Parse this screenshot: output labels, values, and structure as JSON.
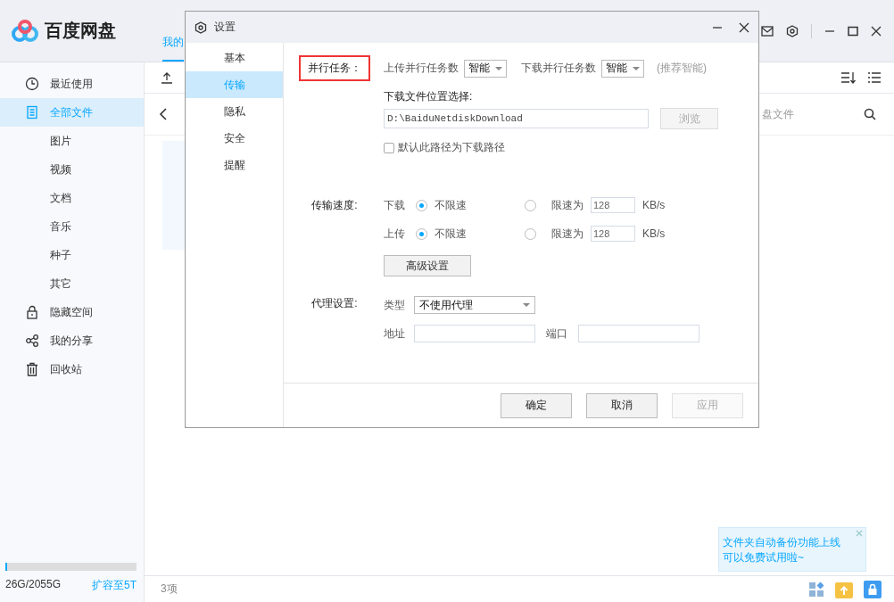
{
  "app": {
    "logo": "百度网盘",
    "tab": "我的"
  },
  "sidebar": {
    "items": [
      {
        "label": "最近使用",
        "selected": false
      },
      {
        "label": "全部文件",
        "selected": true,
        "children": [
          {
            "label": "图片",
            "selected": false
          },
          {
            "label": "视频",
            "selected": false
          },
          {
            "label": "文档",
            "selected": false
          },
          {
            "label": "音乐",
            "selected": false
          },
          {
            "label": "种子",
            "selected": false
          },
          {
            "label": "其它",
            "selected": false
          }
        ]
      },
      {
        "label": "隐藏空间",
        "selected": false
      },
      {
        "label": "我的分享",
        "selected": false
      },
      {
        "label": "回收站",
        "selected": false
      }
    ],
    "storage": {
      "text": "26G/2055G",
      "level": 0.013,
      "upgrade": "扩容至5T"
    }
  },
  "content": {
    "search_placeholder": "盘文件",
    "item_count": "3项"
  },
  "toast": {
    "lines": [
      "文件夹自动备份功能上线",
      "可以免费试用啦~"
    ]
  },
  "dialog": {
    "title": "设置",
    "nav": [
      {
        "label": "基本",
        "selected": false
      },
      {
        "label": "传输",
        "selected": true
      },
      {
        "label": "隐私",
        "selected": false
      },
      {
        "label": "安全",
        "selected": false
      },
      {
        "label": "提醒",
        "selected": false
      }
    ],
    "parallel": {
      "label": "并行任务：",
      "highlighted": true,
      "upload_label": "上传并行任务数",
      "upload_value": "智能",
      "download_label": "下载并行任务数",
      "download_value": "智能",
      "hint": "(推荐智能)"
    },
    "location": {
      "label": "下载文件位置选择:",
      "path": "D:\\BaiduNetdiskDownload",
      "browse": "浏览",
      "browse_disabled": true,
      "default_label": "默认此路径为下载路径",
      "default_checked": false
    },
    "speed": {
      "label": "传输速度:",
      "rows": [
        {
          "direction": "下载",
          "unlimited_label": "不限速",
          "unlimited": true,
          "limit_label": "限速为",
          "limit_value": "128",
          "unit": "KB/s"
        },
        {
          "direction": "上传",
          "unlimited_label": "不限速",
          "unlimited": true,
          "limit_label": "限速为",
          "limit_value": "128",
          "unit": "KB/s"
        }
      ],
      "advanced": "高级设置"
    },
    "proxy": {
      "label": "代理设置:",
      "type_label": "类型",
      "type_value": "不使用代理",
      "address_label": "地址",
      "port_label": "端口"
    },
    "buttons": [
      {
        "label": "确定",
        "disabled": false
      },
      {
        "label": "取消",
        "disabled": false
      },
      {
        "label": "应用",
        "disabled": true
      }
    ]
  }
}
